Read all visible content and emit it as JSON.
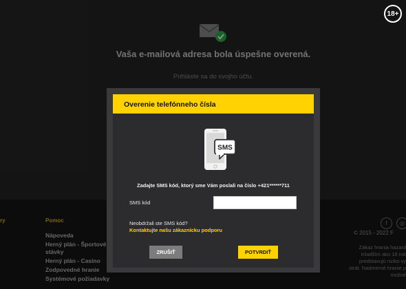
{
  "age_badge": "18+",
  "background": {
    "verified_title": "Vaša e-mailová adresa bola úspešne overená.",
    "login_hint": "Prihláste sa do svojho účtu.",
    "icons": {
      "mail": "mail-icon",
      "check": "check-badge-icon"
    }
  },
  "footer": {
    "left_word": "ry",
    "help_title": "Pomoc",
    "links": [
      "Nápoveda",
      "Herný plán - Športové stávky",
      "Herný plán - Casino",
      "Zodpovedné hranie",
      "Systémové požiadavky"
    ],
    "copyright": "© 2015 - 2022 F",
    "legal_lines": [
      "Zákaz hrania hazard",
      "mladším ako 18 rok",
      "predstavujú riziko vy",
      "strát. Nadmerné hranie p",
      "možné"
    ],
    "social": [
      "f",
      "◎"
    ]
  },
  "modal": {
    "title": "Overenie telefónneho čísla",
    "sms_icon_text": "SMS",
    "instruction": "Zadajte SMS kód, ktorý sme Vám poslali na číslo +421******711",
    "sms_label": "SMS kód",
    "sms_value": "",
    "not_received": "Neobdržali ste SMS kód?",
    "support_link": "Kontaktujte našu zákaznícku podporu",
    "cancel_label": "ZRUŠIŤ",
    "confirm_label": "POTVRDIŤ"
  },
  "colors": {
    "accent": "#ffd200",
    "modal_bg": "#3a3a3c",
    "modal_body": "#2c2c2e",
    "cancel_bg": "#7c7c7c"
  }
}
